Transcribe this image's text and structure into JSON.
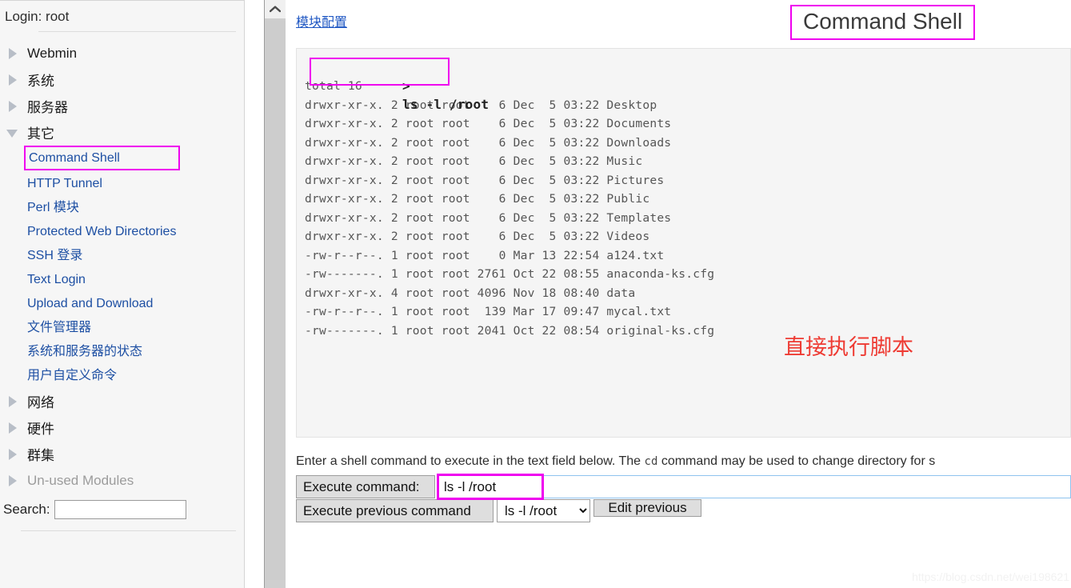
{
  "sidebar": {
    "login_label": "Login: root",
    "nav": [
      {
        "label": "Webmin",
        "state": "collapsed",
        "children": []
      },
      {
        "label": "系统",
        "state": "collapsed",
        "children": []
      },
      {
        "label": "服务器",
        "state": "collapsed",
        "children": []
      },
      {
        "label": "其它",
        "state": "expanded",
        "children": [
          "Command Shell",
          "HTTP Tunnel",
          "Perl 模块",
          "Protected Web Directories",
          "SSH 登录",
          "Text Login",
          "Upload and Download",
          "文件管理器",
          "系统和服务器的状态",
          "用户自定义命令"
        ]
      },
      {
        "label": "网络",
        "state": "collapsed",
        "children": []
      },
      {
        "label": "硬件",
        "state": "collapsed",
        "children": []
      },
      {
        "label": "群集",
        "state": "collapsed",
        "children": []
      },
      {
        "label": "Un-used Modules",
        "state": "collapsed",
        "dim": true,
        "children": []
      }
    ],
    "search_label": "Search:",
    "search_value": "",
    "highlighted_item": "Command Shell"
  },
  "main": {
    "module_config_link": "模块配置",
    "page_title": "Command Shell",
    "annotation_red": "直接执行脚本",
    "terminal": {
      "prompt_symbol": ">",
      "prompt_command": "ls -l /root",
      "output_lines": [
        "total 16",
        "drwxr-xr-x. 2 root root    6 Dec  5 03:22 Desktop",
        "drwxr-xr-x. 2 root root    6 Dec  5 03:22 Documents",
        "drwxr-xr-x. 2 root root    6 Dec  5 03:22 Downloads",
        "drwxr-xr-x. 2 root root    6 Dec  5 03:22 Music",
        "drwxr-xr-x. 2 root root    6 Dec  5 03:22 Pictures",
        "drwxr-xr-x. 2 root root    6 Dec  5 03:22 Public",
        "drwxr-xr-x. 2 root root    6 Dec  5 03:22 Templates",
        "drwxr-xr-x. 2 root root    6 Dec  5 03:22 Videos",
        "-rw-r--r--. 1 root root    0 Mar 13 22:54 a124.txt",
        "-rw-------. 1 root root 2761 Oct 22 08:55 anaconda-ks.cfg",
        "drwxr-xr-x. 4 root root 4096 Nov 18 08:40 data",
        "-rw-r--r--. 1 root root  139 Mar 17 09:47 mycal.txt",
        "-rw-------. 1 root root 2041 Oct 22 08:54 original-ks.cfg"
      ]
    },
    "description_prefix": "Enter a shell command to execute in the text field below. The ",
    "description_mono": "cd",
    "description_suffix": " command may be used to change directory for s",
    "execute_button": "Execute command:",
    "command_value": "ls -l /root",
    "command_placeholder": "",
    "execute_prev_button": "Execute previous command",
    "prev_select_value": "ls -l /root",
    "edit_prev_button": "Edit previous"
  },
  "watermark": "https://blog.csdn.net/wei198621",
  "colors": {
    "highlight_magenta": "#ef00ef",
    "link_blue": "#1d4fa3",
    "annotation_red": "#ee3b33",
    "terminal_bg": "#f5f5f5",
    "sidebar_bg": "#f6f6f6"
  }
}
